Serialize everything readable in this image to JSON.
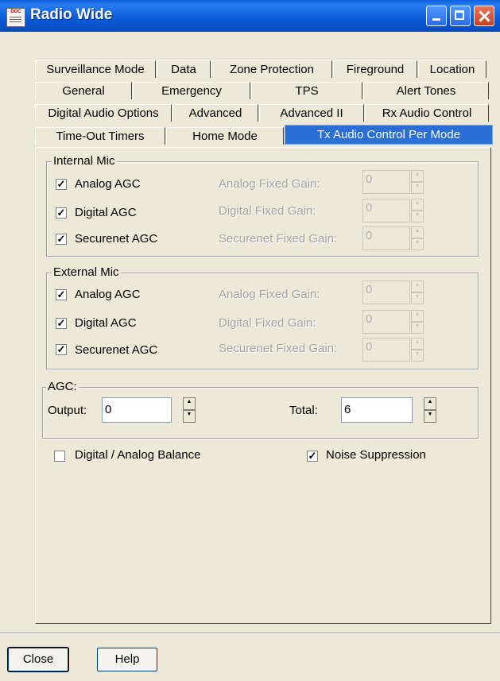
{
  "window": {
    "title": "Radio Wide",
    "icon_text": "DOC"
  },
  "tabs": {
    "row1": [
      "Surveillance Mode",
      "Data",
      "Zone Protection",
      "Fireground",
      "Location"
    ],
    "row2": [
      "General",
      "Emergency",
      "TPS",
      "Alert Tones"
    ],
    "row3": [
      "Digital Audio Options",
      "Advanced",
      "Advanced II",
      "Rx Audio Control"
    ],
    "row4": [
      "Time-Out Timers",
      "Home Mode",
      "Tx Audio Control Per Mode"
    ]
  },
  "internal_mic": {
    "legend": "Internal Mic",
    "rows": [
      {
        "agc_label": "Analog AGC",
        "checked": true,
        "gain_label": "Analog Fixed Gain:",
        "gain_value": "0"
      },
      {
        "agc_label": "Digital AGC",
        "checked": true,
        "gain_label": "Digital Fixed Gain:",
        "gain_value": "0"
      },
      {
        "agc_label": "Securenet AGC",
        "checked": true,
        "gain_label": "Securenet Fixed Gain:",
        "gain_value": "0"
      }
    ]
  },
  "external_mic": {
    "legend": "External Mic",
    "rows": [
      {
        "agc_label": "Analog AGC",
        "checked": true,
        "gain_label": "Analog Fixed Gain:",
        "gain_value": "0"
      },
      {
        "agc_label": "Digital AGC",
        "checked": true,
        "gain_label": "Digital Fixed Gain:",
        "gain_value": "0"
      },
      {
        "agc_label": "Securenet AGC",
        "checked": true,
        "gain_label": "Securenet Fixed Gain:",
        "gain_value": "0"
      }
    ]
  },
  "agc": {
    "legend": "AGC:",
    "output_label": "Output:",
    "output_value": "0",
    "total_label": "Total:",
    "total_value": "6"
  },
  "options": {
    "balance_label": "Digital / Analog Balance",
    "balance_checked": false,
    "noise_label": "Noise Suppression",
    "noise_checked": true
  },
  "buttons": {
    "close": "Close",
    "help": "Help"
  },
  "colors": {
    "title_bar": "#0a5ad6",
    "active_tab": "#2b6fd6",
    "face": "#ece9d8"
  }
}
